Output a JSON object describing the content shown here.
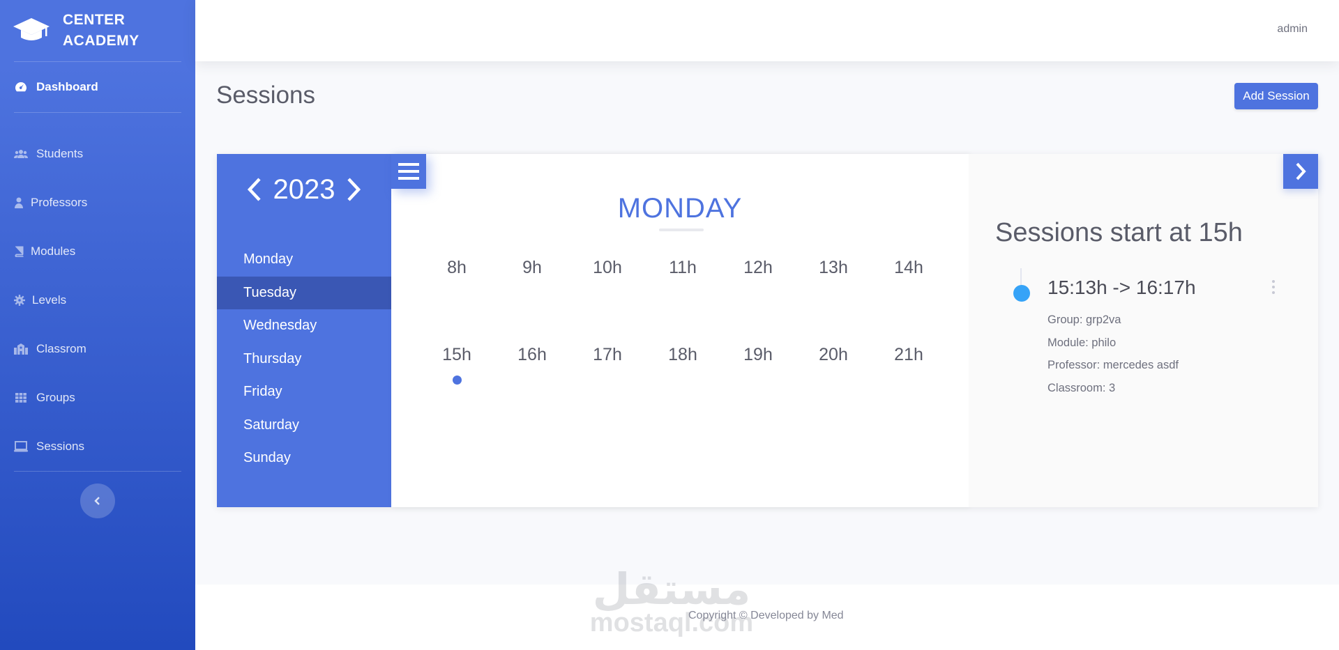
{
  "brand": {
    "name_line1": "CENTER",
    "name_line2": "ACADEMY",
    "icon": "graduation-cap-icon"
  },
  "sidebar": {
    "dashboard": {
      "label": "Dashboard",
      "icon": "tachometer-icon"
    },
    "items": [
      {
        "label": "Students",
        "icon": "users-icon"
      },
      {
        "label": "Professors",
        "icon": "user-icon"
      },
      {
        "label": "Modules",
        "icon": "book-icon"
      },
      {
        "label": "Levels",
        "icon": "cog-icon"
      },
      {
        "label": "Classrom",
        "icon": "school-icon"
      },
      {
        "label": "Groups",
        "icon": "grid-icon"
      },
      {
        "label": "Sessions",
        "icon": "laptop-icon"
      }
    ],
    "toggle_icon": "chevron-left-icon"
  },
  "topbar": {
    "user": "admin"
  },
  "page": {
    "title": "Sessions",
    "add_button": "Add Session"
  },
  "calendar": {
    "year": "2023",
    "days": [
      "Monday",
      "Tuesday",
      "Wednesday",
      "Thursday",
      "Friday",
      "Saturday",
      "Sunday"
    ],
    "selected_day": "Tuesday",
    "current_day_title": "MONDAY",
    "hours_row1": [
      "8h",
      "9h",
      "10h",
      "11h",
      "12h",
      "13h",
      "14h"
    ],
    "hours_row2": [
      "15h",
      "16h",
      "17h",
      "18h",
      "19h",
      "20h",
      "21h"
    ],
    "hours_with_sessions": [
      "15h"
    ]
  },
  "sessions_panel": {
    "heading": "Sessions start at 15h",
    "session": {
      "time": "15:13h -> 16:17h",
      "group": "Group: grp2va",
      "module": "Module: philo",
      "professor": "Professor: mercedes asdf",
      "classroom": "Classroom: 3"
    }
  },
  "footer": {
    "copyright": "Copyright © Developed by Med",
    "watermark_ar": "مستقل",
    "watermark_en": "mostaql.com"
  },
  "colors": {
    "primary": "#4e73df",
    "primary_dark": "#224abe",
    "selected": "#3a57b4",
    "timeline_dot": "#36a3f7"
  }
}
